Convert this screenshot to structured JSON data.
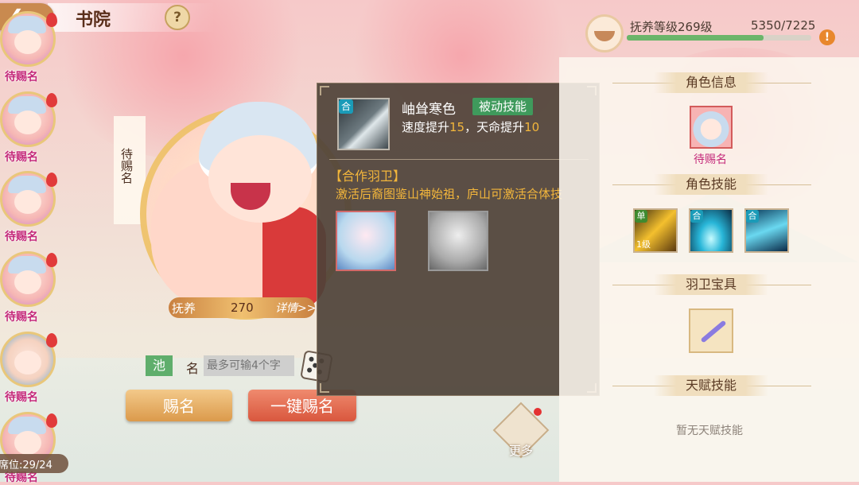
{
  "header": {
    "title": "书院",
    "back_icon": "back-arrow-icon",
    "help_icon": "question-mark-icon"
  },
  "avatar_list": {
    "items": [
      {
        "label": "待赐名"
      },
      {
        "label": "待赐名"
      },
      {
        "label": "待赐名"
      },
      {
        "label": "待赐名"
      },
      {
        "label": "待赐名"
      },
      {
        "label": "待赐名"
      }
    ],
    "seat_text": "席位:29/24"
  },
  "character": {
    "vertical_name": "待赐名",
    "foster_label": "抚养",
    "foster_value": "270",
    "detail_label": "详情>>"
  },
  "naming": {
    "pool_label": "池",
    "name_label": "名",
    "name_placeholder": "最多可输4个字",
    "dice_icon": "dice-icon",
    "name_button": "赐名",
    "one_key_button": "一键赐名"
  },
  "popup": {
    "skill_tag": "合",
    "skill_name": "岫耸寒色",
    "skill_type": "被动技能",
    "desc_prefix": "速度提升",
    "desc_val1": "15",
    "desc_mid": "，天命提升",
    "desc_val2": "10",
    "coop_title": "【合作羽卫】",
    "coop_desc": "激活后裔图鉴山神始祖，庐山可激活合体技"
  },
  "right_panel": {
    "exp_label": "抚养等级269级",
    "exp_value": "5350/7225",
    "exp_progress": 0.74,
    "warn_icon": "!",
    "sections": {
      "role_info": "角色信息",
      "role_skills": "角色技能",
      "treasure": "羽卫宝具",
      "talent": "天赋技能"
    },
    "role_name": "待赐名",
    "skills": [
      {
        "tag": "单",
        "level": "1级",
        "tag_color": "#3f8a2f"
      },
      {
        "tag": "合",
        "tag_color": "#1a9bb8"
      },
      {
        "tag": "合",
        "tag_color": "#1a9bb8"
      }
    ],
    "no_talent": "暂无天赋技能"
  },
  "more": {
    "label": "更多"
  },
  "colors": {
    "accent": "#db9a4b",
    "danger": "#d9573e",
    "skill_green": "#3f9a5c"
  }
}
